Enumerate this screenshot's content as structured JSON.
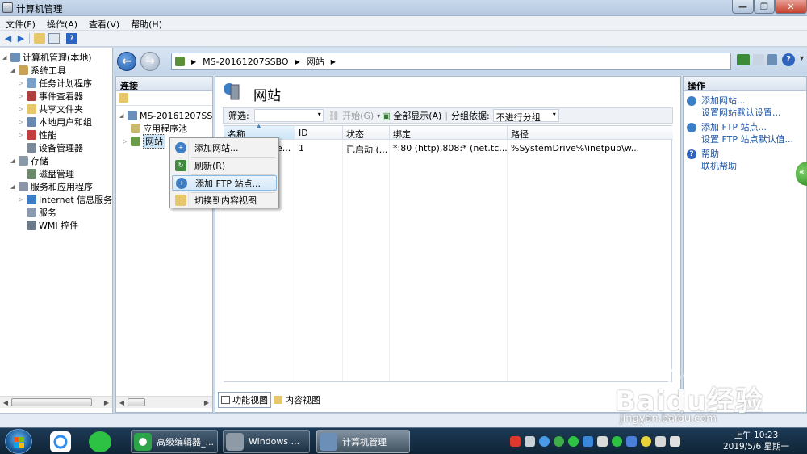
{
  "window": {
    "title": "计算机管理"
  },
  "menu": [
    "文件(F)",
    "操作(A)",
    "查看(V)",
    "帮助(H)"
  ],
  "left_tree": [
    {
      "label": "计算机管理(本地)",
      "level": 0,
      "icon": "computer-icon"
    },
    {
      "label": "系统工具",
      "level": 1,
      "icon": "tools-icon"
    },
    {
      "label": "任务计划程序",
      "level": 2,
      "icon": "clock-icon"
    },
    {
      "label": "事件查看器",
      "level": 2,
      "icon": "event-viewer-icon"
    },
    {
      "label": "共享文件夹",
      "level": 2,
      "icon": "shared-folder-icon"
    },
    {
      "label": "本地用户和组",
      "level": 2,
      "icon": "users-icon"
    },
    {
      "label": "性能",
      "level": 2,
      "icon": "performance-icon"
    },
    {
      "label": "设备管理器",
      "level": 2,
      "icon": "device-manager-icon"
    },
    {
      "label": "存储",
      "level": 1,
      "icon": "storage-icon"
    },
    {
      "label": "磁盘管理",
      "level": 2,
      "icon": "disk-icon"
    },
    {
      "label": "服务和应用程序",
      "level": 1,
      "icon": "services-apps-icon"
    },
    {
      "label": "Internet 信息服务",
      "level": 2,
      "icon": "iis-icon"
    },
    {
      "label": "服务",
      "level": 2,
      "icon": "services-icon"
    },
    {
      "label": "WMI 控件",
      "level": 2,
      "icon": "wmi-icon"
    }
  ],
  "address": {
    "segments": [
      "MS-20161207SSBO",
      "网站"
    ]
  },
  "connections": {
    "header": "连接",
    "server": "MS-20161207SS",
    "app_pool": "应用程序池",
    "sites": "网站"
  },
  "center": {
    "title": "网站",
    "filter_label": "筛选:",
    "start_label": "开始(G)",
    "show_all_label": "全部显示(A)",
    "group_by_label": "分组依据:",
    "group_by_value": "不进行分组",
    "columns": [
      "名称",
      "ID",
      "状态",
      "绑定",
      "路径"
    ],
    "rows": [
      {
        "name": "…e...",
        "id": "1",
        "status": "已启动 (...",
        "binding": "*:80 (http),808:* (net.tc...",
        "path": "%SystemDrive%\\inetpub\\w..."
      }
    ],
    "view_tabs": [
      "功能视图",
      "内容视图"
    ]
  },
  "context_menu": [
    {
      "label": "添加网站...",
      "icon": "add-website-icon",
      "highlighted": false
    },
    {
      "label": "刷新(R)",
      "icon": "refresh-icon",
      "highlighted": false
    },
    {
      "label": "添加 FTP 站点...",
      "icon": "add-ftp-icon",
      "highlighted": true
    },
    {
      "label": "切换到内容视图",
      "icon": "content-view-icon",
      "highlighted": false
    }
  ],
  "actions": {
    "header": "操作",
    "groups": [
      {
        "icon": "add-website-icon",
        "items": [
          "添加网站...",
          "设置网站默认设置..."
        ]
      },
      {
        "icon": "add-ftp-icon",
        "items": [
          "添加 FTP 站点...",
          "设置 FTP 站点默认值..."
        ]
      },
      {
        "icon": "help-icon",
        "items": [
          "帮助",
          "联机帮助"
        ]
      }
    ]
  },
  "taskbar": {
    "apps": [
      "高级编辑器_...",
      "Windows ...",
      "计算机管理"
    ],
    "time": "上午 10:23",
    "date": "2019/5/6 星期一"
  },
  "watermark": {
    "brand": "Baidu经验",
    "url": "jingyan.baidu.com"
  },
  "colors": {
    "accent": "#1c55a7",
    "highlight": "#cde6f7",
    "taskbar": "#1a3148"
  }
}
